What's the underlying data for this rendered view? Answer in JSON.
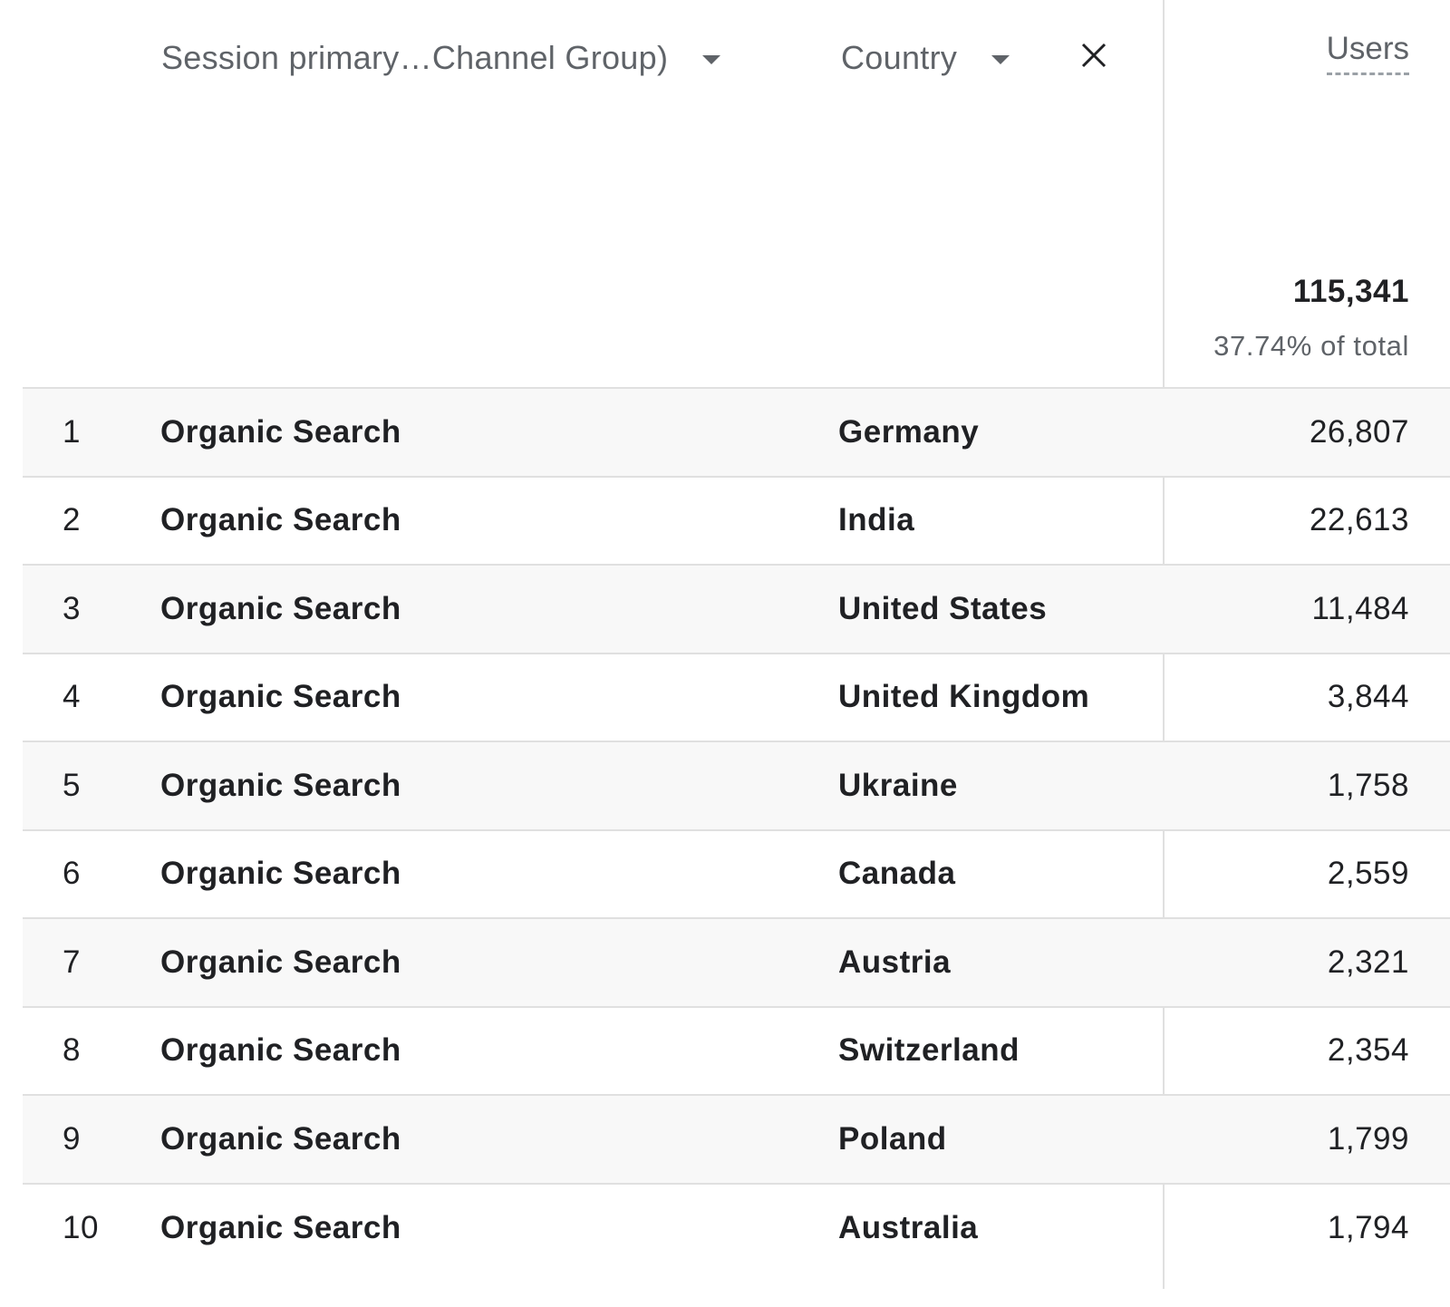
{
  "header": {
    "dimension1_label": "Session primary…Channel Group)",
    "dimension2_label": "Country",
    "metric_label": "Users",
    "total_value": "115,341",
    "total_subtext": "37.74% of total"
  },
  "rows": [
    {
      "index": "1",
      "channel": "Organic Search",
      "country": "Germany",
      "users": "26,807"
    },
    {
      "index": "2",
      "channel": "Organic Search",
      "country": "India",
      "users": "22,613"
    },
    {
      "index": "3",
      "channel": "Organic Search",
      "country": "United States",
      "users": "11,484"
    },
    {
      "index": "4",
      "channel": "Organic Search",
      "country": "United Kingdom",
      "users": "3,844"
    },
    {
      "index": "5",
      "channel": "Organic Search",
      "country": "Ukraine",
      "users": "1,758"
    },
    {
      "index": "6",
      "channel": "Organic Search",
      "country": "Canada",
      "users": "2,559"
    },
    {
      "index": "7",
      "channel": "Organic Search",
      "country": "Austria",
      "users": "2,321"
    },
    {
      "index": "8",
      "channel": "Organic Search",
      "country": "Switzerland",
      "users": "2,354"
    },
    {
      "index": "9",
      "channel": "Organic Search",
      "country": "Poland",
      "users": "1,799"
    },
    {
      "index": "10",
      "channel": "Organic Search",
      "country": "Australia",
      "users": "1,794"
    }
  ],
  "colors": {
    "header_text": "#5f6368",
    "body_text": "#202124",
    "row_alt_bg": "#f8f8f8",
    "divider": "#e0e0e0"
  },
  "icons": {
    "dropdown": "caret-down-icon",
    "remove": "close-icon"
  }
}
